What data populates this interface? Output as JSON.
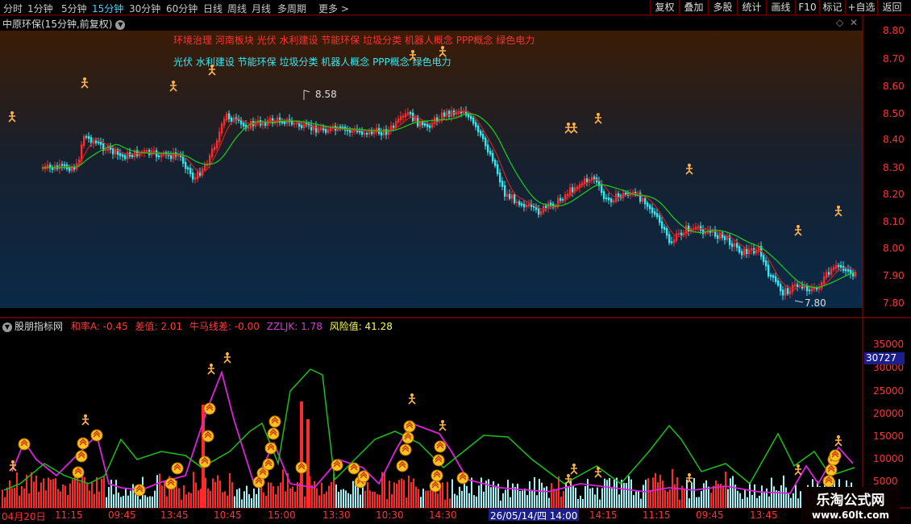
{
  "toolbar": {
    "periods": [
      "分时",
      "1分钟",
      "5分钟",
      "15分钟",
      "30分钟",
      "60分钟",
      "日线",
      "周线",
      "月线",
      "多周期",
      "更多 >"
    ],
    "active_period": "15分钟",
    "right_buttons": [
      "复权",
      "叠加",
      "多股",
      "统计",
      "画线",
      "F10",
      "标记",
      "+自选",
      "返回"
    ]
  },
  "main_chart": {
    "title": "中原环保(15分钟,前复权)",
    "diamond_icon": "◇",
    "close_icon": "✕",
    "concepts_red": "环境治理 河南板块 光伏 水利建设 节能环保 垃圾分类 机器人概念 PPP概念 绿色电力",
    "concepts_cyan": "光伏 水利建设 节能环保 垃圾分类 机器人概念 PPP概念 绿色电力",
    "high_label": "8.58",
    "low_label": "7.80",
    "y_ticks": [
      "8.80",
      "8.70",
      "8.60",
      "8.50",
      "8.40",
      "8.30",
      "8.20",
      "8.10",
      "8.00",
      "7.90",
      "7.80"
    ]
  },
  "indicator": {
    "title": "股朋指标网",
    "values": [
      {
        "label": "和率A: -0.45",
        "color": "#ff3b3b"
      },
      {
        "label": "差值: 2.01",
        "color": "#ff3b3b"
      },
      {
        "label": "牛马线差: -0.00",
        "color": "#ff3b3b"
      },
      {
        "label": "ZZLJK: 1.78",
        "color": "#d040d0"
      },
      {
        "label": "风险值: 41.28",
        "color": "#ffff55"
      }
    ],
    "y_ticks": [
      "35000",
      "30000",
      "25000",
      "20000",
      "15000",
      "10000",
      "5000"
    ],
    "current_value": "30727"
  },
  "x_axis": {
    "labels": [
      "04月20日",
      "11:15",
      "09:45",
      "13:45",
      "10:45",
      "15:00",
      "13:30",
      "10:30",
      "14:30",
      "14:15",
      "11:15",
      "09:45",
      "13:45"
    ],
    "cursor_label": "26/05/14/四 14:00"
  },
  "logo": {
    "name": "乐淘公式网",
    "url": "www.60lt.com"
  },
  "colors": {
    "up": "#ff2a2a",
    "down": "#35e8f0",
    "ma_red": "#d02020",
    "ma_green": "#19d019",
    "accent": "#4ad3ff",
    "magenta": "#e020e0"
  }
}
